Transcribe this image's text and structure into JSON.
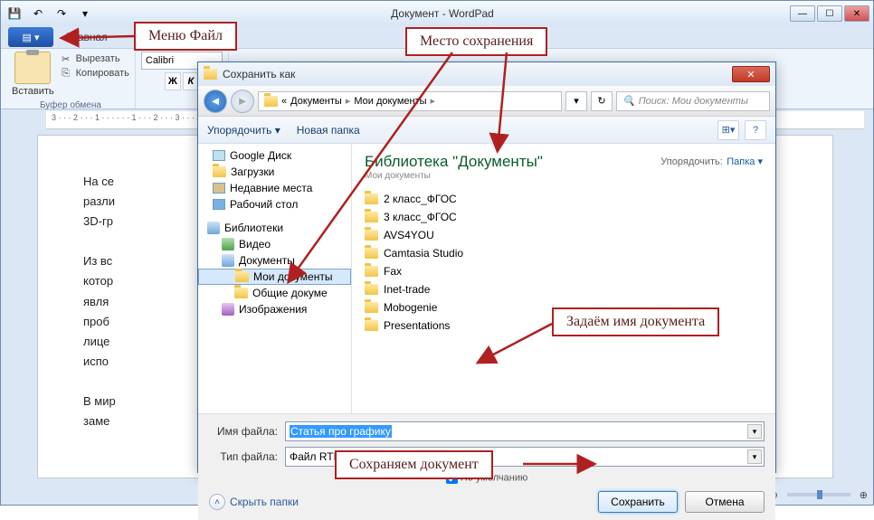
{
  "wordpad": {
    "title": "Документ - WordPad",
    "tab_home": "Главная",
    "clipboard": {
      "paste": "Вставить",
      "cut": "Вырезать",
      "copy": "Копировать",
      "group": "Буфер обмена"
    },
    "font_name": "Calibri",
    "ruler": "3 · · · 2 · · · 1 · · · · · · 1 · · · 2 · · · 3 · · · 4 · · · 5 · · · 6 · · · 7 · · · 8 · · · 9 · · · 10 · · · 11 · · · 12 · · · 13 · · · 14 · · · 15",
    "doc_lines": [
      "На се",
      "разли",
      "3D-гр",
      "",
      "Из вс",
      "котор",
      "явля",
      "проб",
      "лице",
      "испо",
      "",
      "В мир",
      "заме"
    ],
    "zoom": "100%"
  },
  "dialog": {
    "title": "Сохранить как",
    "toolbar": {
      "organize": "Упорядочить ▾",
      "newfolder": "Новая папка"
    },
    "breadcrumb": {
      "root": "Документы",
      "folder": "Мои документы",
      "prefix": "«"
    },
    "search_placeholder": "Поиск: Мои документы",
    "tree": {
      "gdrive": "Google Диск",
      "downloads": "Загрузки",
      "recent": "Недавние места",
      "desktop": "Рабочий стол",
      "libraries": "Библиотеки",
      "video": "Видео",
      "documents": "Документы",
      "mydocs": "Мои документы",
      "publicdocs": "Общие докуме",
      "images": "Изображения"
    },
    "list_header": {
      "title": "Библиотека \"Документы\"",
      "subtitle": "Мои документы",
      "sort_label": "Упорядочить:",
      "sort_value": "Папка ▾"
    },
    "files": [
      "2 класс_ФГОС",
      "3 класс_ФГОС",
      "AVS4YOU",
      "Camtasia Studio",
      "Fax",
      "Inet-trade",
      "Mobogenie",
      "Presentations"
    ],
    "filename_label": "Имя файла:",
    "filename_value": "Статья про графику",
    "filetype_label": "Тип файла:",
    "filetype_value": "Файл RTF",
    "default_check": "По умолчанию",
    "hide_folders": "Скрыть папки",
    "save": "Сохранить",
    "cancel": "Отмена"
  },
  "callouts": {
    "menu": "Меню Файл",
    "saveplace": "Место сохранения",
    "name": "Задаём имя документа",
    "savebtn": "Сохраняем документ"
  }
}
